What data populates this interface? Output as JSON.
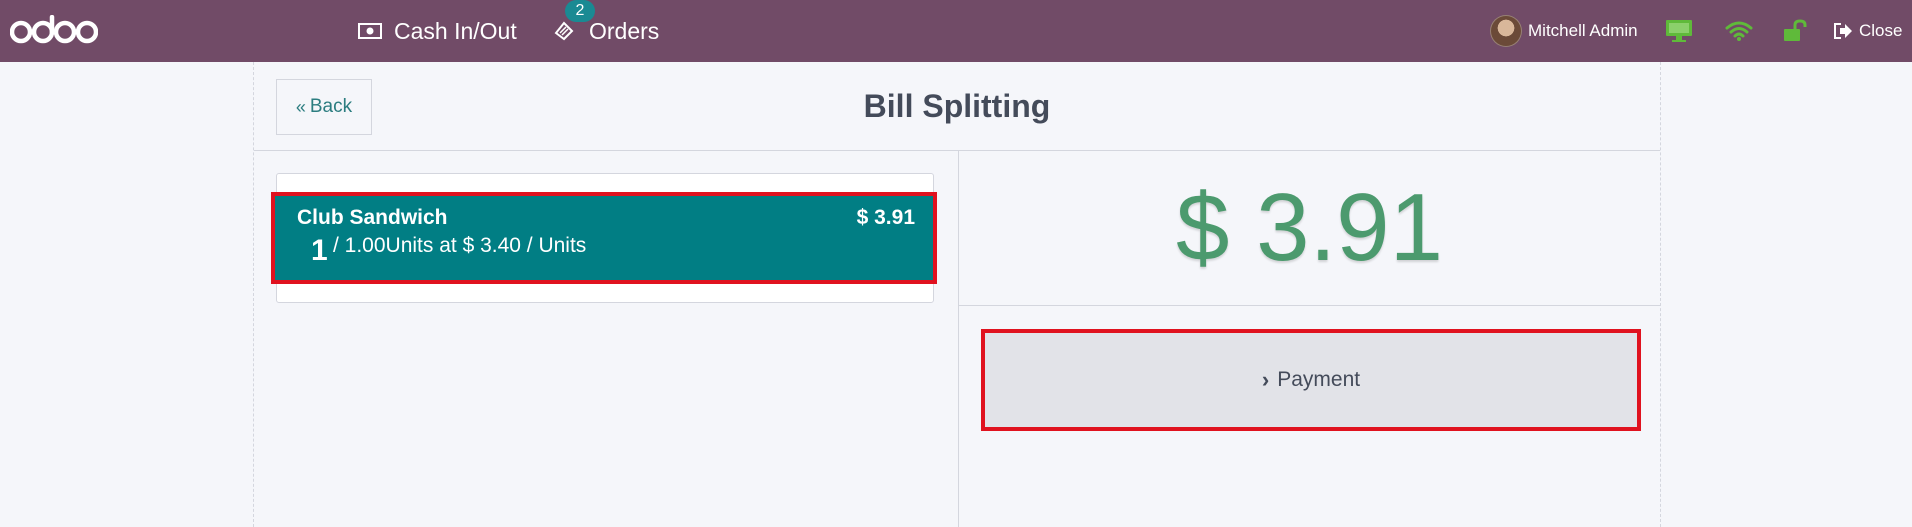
{
  "navbar": {
    "logo_text": "odoo",
    "cash_label": "Cash In/Out",
    "orders_label": "Orders",
    "orders_badge": "2",
    "user_name": "Mitchell Admin",
    "close_label": "Close"
  },
  "colors": {
    "navbar": "#714b67",
    "accent": "#017e84",
    "total": "#4c9a6e",
    "status_ok": "#5fba3a",
    "highlight": "#e0121f"
  },
  "icons": {
    "cash": "money-icon",
    "orders": "ticket-icon",
    "monitor": "monitor-icon",
    "wifi": "wifi-icon",
    "lock": "unlock-icon",
    "close": "sign-out-icon"
  },
  "screen": {
    "back_label": "Back",
    "title": "Bill Splitting",
    "orderline": {
      "name": "Club Sandwich",
      "price": "$ 3.91",
      "qty": "1",
      "info": "/ 1.00Units at $ 3.40 / Units"
    },
    "total": "$ 3.91",
    "payment_label": "Payment"
  }
}
